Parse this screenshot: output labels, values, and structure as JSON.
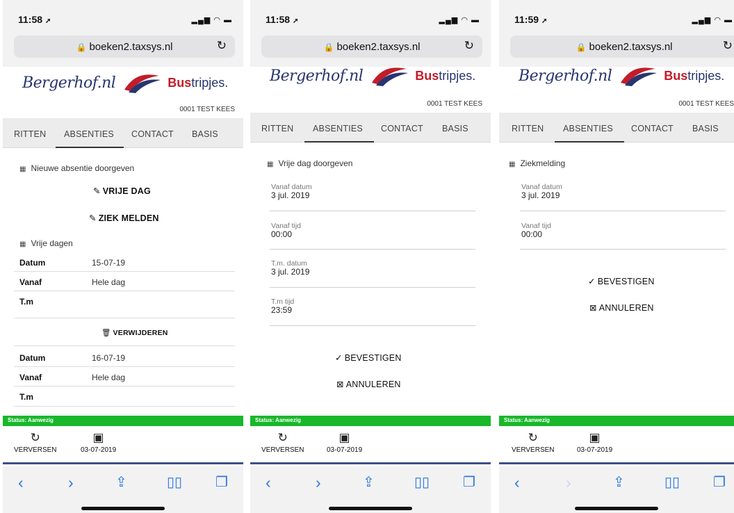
{
  "screens": [
    {
      "time": "11:58",
      "url": "boeken2.taxsys.nl",
      "brand": {
        "script": "Bergerhof.nl",
        "bus": "Bus",
        "trip": "tripjes."
      },
      "user": "0001 TEST KEES",
      "tabs": [
        "RITTEN",
        "ABSENTIES",
        "CONTACT",
        "BASIS"
      ],
      "section_new": "Nieuwe absentie doorgeven",
      "btn_vrije_dag": "VRIJE DAG",
      "btn_ziek": "ZIEK MELDEN",
      "section_free_days": "Vrije dagen",
      "entries": [
        {
          "datum_label": "Datum",
          "datum": "15-07-19",
          "vanaf_label": "Vanaf",
          "vanaf": "Hele dag",
          "tm_label": "T.m",
          "tm": ""
        },
        {
          "datum_label": "Datum",
          "datum": "16-07-19",
          "vanaf_label": "Vanaf",
          "vanaf": "Hele dag",
          "tm_label": "T.m",
          "tm": ""
        }
      ],
      "btn_delete": "VERWIJDEREN",
      "status": "Status: Aanwezig",
      "refresh_label": "VERVERSEN",
      "date_label": "03-07-2019"
    },
    {
      "time": "11:58",
      "url": "boeken2.taxsys.nl",
      "brand": {
        "script": "Bergerhof.nl",
        "bus": "Bus",
        "trip": "tripjes."
      },
      "user": "0001 TEST KEES",
      "tabs": [
        "RITTEN",
        "ABSENTIES",
        "CONTACT",
        "BASIS"
      ],
      "section_title": "Vrije dag doorgeven",
      "fields": [
        {
          "label": "Vanaf datum",
          "value": "3 jul. 2019"
        },
        {
          "label": "Vanaf tijd",
          "value": "00:00"
        },
        {
          "label": "T.m. datum",
          "value": "3 jul. 2019"
        },
        {
          "label": "T.m tijd",
          "value": "23:59"
        }
      ],
      "btn_confirm": "BEVESTIGEN",
      "btn_cancel": "ANNULEREN",
      "status": "Status: Aanwezig",
      "refresh_label": "VERVERSEN",
      "date_label": "03-07-2019"
    },
    {
      "time": "11:59",
      "url": "boeken2.taxsys.nl",
      "brand": {
        "script": "Bergerhof.nl",
        "bus": "Bus",
        "trip": "tripjes."
      },
      "user": "0001 TEST KEES",
      "tabs": [
        "RITTEN",
        "ABSENTIES",
        "CONTACT",
        "BASIS"
      ],
      "section_title": "Ziekmelding",
      "fields": [
        {
          "label": "Vanaf datum",
          "value": "3 jul. 2019"
        },
        {
          "label": "Vanaf tijd",
          "value": "00:00"
        }
      ],
      "btn_confirm": "BEVESTIGEN",
      "btn_cancel": "ANNULEREN",
      "status": "Status: Aanwezig",
      "refresh_label": "VERVERSEN",
      "date_label": "03-07-2019"
    }
  ],
  "icons": {
    "location": "location-arrow-icon",
    "lock": "lock-icon",
    "reload": "reload-icon",
    "grid": "grid-icon",
    "pencil": "pencil-icon",
    "trash": "trash-icon",
    "check": "checkmark-icon",
    "cancel": "cancel-box-icon",
    "refresh": "refresh-icon",
    "calendar": "calendar-icon",
    "back": "back-chevron-icon",
    "forward": "forward-chevron-icon",
    "share": "share-icon",
    "bookmarks": "bookmarks-icon",
    "tabs": "tabs-icon"
  },
  "colors": {
    "brand_navy": "#28356f",
    "brand_red": "#c21d2a",
    "status_green": "#18b82a",
    "ios_blue": "#2b76e6",
    "nav_divider": "#3d4f8a"
  }
}
